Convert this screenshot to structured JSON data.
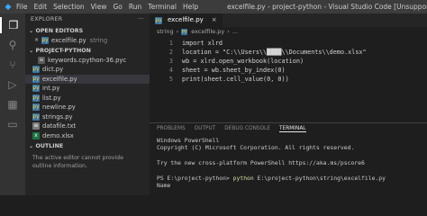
{
  "window": {
    "title": "excelfile.py - project-python - Visual Studio Code [Unsupported]",
    "logo_icon": "vscode-logo"
  },
  "menu": [
    "File",
    "Edit",
    "Selection",
    "View",
    "Go",
    "Run",
    "Terminal",
    "Help"
  ],
  "activity_bar": [
    "files-icon",
    "search-icon",
    "source-control-icon",
    "run-debug-icon",
    "extensions-icon",
    "remote-explorer-icon"
  ],
  "explorer": {
    "header": "EXPLORER",
    "more": "···",
    "open_editors_label": "OPEN EDITORS",
    "open_editors": [
      {
        "name": "excelfile.py",
        "folder": "string"
      }
    ],
    "project_label": "PROJECT-PYTHON",
    "files": [
      {
        "name": "keywords.cpython-36.pyc",
        "kind": "pyc",
        "selected": false
      },
      {
        "name": "dict.py",
        "kind": "py",
        "selected": false
      },
      {
        "name": "excelfile.py",
        "kind": "py",
        "selected": true
      },
      {
        "name": "int.py",
        "kind": "py",
        "selected": false
      },
      {
        "name": "list.py",
        "kind": "py",
        "selected": false
      },
      {
        "name": "newline.py",
        "kind": "py",
        "selected": false
      },
      {
        "name": "strings.py",
        "kind": "py",
        "selected": false
      },
      {
        "name": "datafile.txt",
        "kind": "txt",
        "selected": false
      },
      {
        "name": "demo.xlsx",
        "kind": "xlsx",
        "selected": false
      }
    ],
    "outline_label": "OUTLINE",
    "outline_hint": "The active editor cannot provide outline information."
  },
  "editor": {
    "tab_label": "excelfile.py",
    "tab_close": "×",
    "breadcrumb": [
      "string",
      "excelfile.py",
      "..."
    ],
    "lines": [
      {
        "n": "1",
        "text": "import xlrd"
      },
      {
        "n": "2",
        "text": "location = \"C:\\\\Users\\\\████\\\\Documents\\\\demo.xlsx\""
      },
      {
        "n": "3",
        "text": "wb = xlrd.open_workbook(location)"
      },
      {
        "n": "4",
        "text": "sheet = wb.sheet_by_index(0)"
      },
      {
        "n": "5",
        "text": "print(sheet.cell_value(0, 0))"
      }
    ]
  },
  "panel": {
    "tabs": [
      "PROBLEMS",
      "OUTPUT",
      "DEBUG CONSOLE",
      "TERMINAL"
    ],
    "active_tab": "TERMINAL",
    "terminal": {
      "line1": "Windows PowerShell",
      "line2": "Copyright (C) Microsoft Corporation. All rights reserved.",
      "line3": "",
      "line4": "Try the new cross-platform PowerShell https://aka.ms/pscore6",
      "line5": "",
      "prompt": "PS E:\\project-python> ",
      "command": "python",
      "command_args": " E:\\project-python\\string\\excelfile.py",
      "output": "Name"
    }
  }
}
